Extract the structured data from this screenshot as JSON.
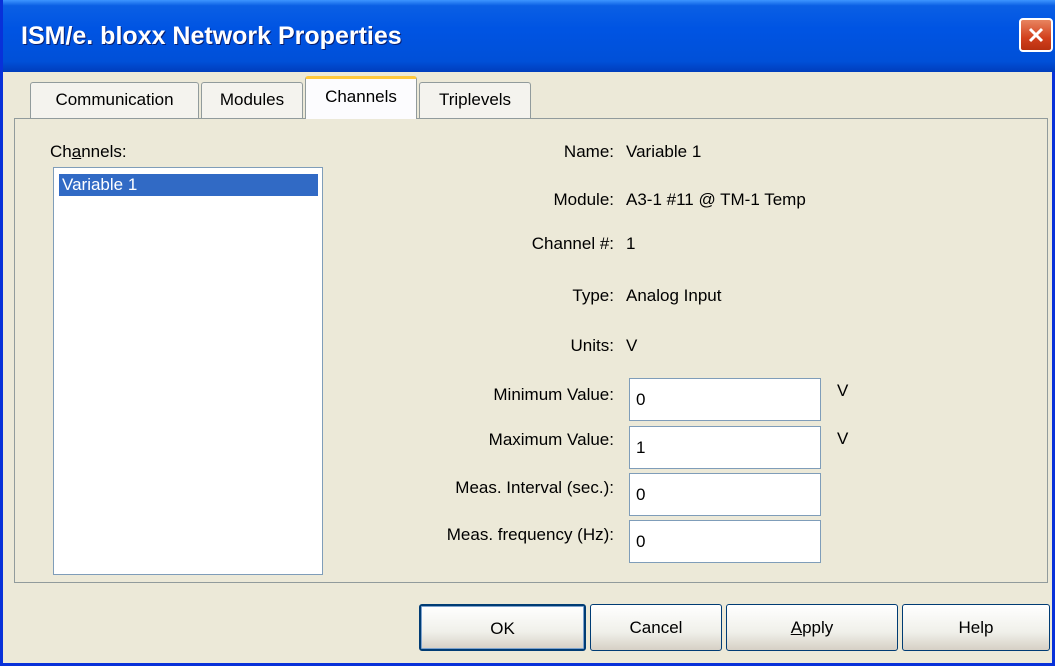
{
  "window": {
    "title": "ISM/e. bloxx Network Properties"
  },
  "tabs": [
    {
      "label": "Communication",
      "active": false
    },
    {
      "label": "Modules",
      "active": false
    },
    {
      "label": "Channels",
      "active": true
    },
    {
      "label": "Triplevels",
      "active": false
    }
  ],
  "channels": {
    "label_pre": "Ch",
    "label_mnemonic": "a",
    "label_post": "nnels:",
    "items": [
      {
        "label": "Variable 1",
        "selected": true
      }
    ]
  },
  "details": {
    "name_label": "Name:",
    "name_value": "Variable 1",
    "module_label": "Module:",
    "module_value": "A3-1 #11 @ TM-1 Temp",
    "channel_label": "Channel #:",
    "channel_value": "1",
    "type_label": "Type:",
    "type_value": "Analog Input",
    "units_label": "Units:",
    "units_value": "V"
  },
  "fields": {
    "min_label": "Minimum Value:",
    "min_value": "0",
    "min_unit": "V",
    "max_label": "Maximum Value:",
    "max_value": "1",
    "max_unit": "V",
    "interval_label": "Meas. Interval (sec.):",
    "interval_value": "0",
    "frequency_label": "Meas. frequency (Hz):",
    "frequency_value": "0"
  },
  "buttons": {
    "ok": "OK",
    "cancel": "Cancel",
    "apply_mnemonic": "A",
    "apply_rest": "pply",
    "help": "Help"
  },
  "colors": {
    "titlebar": "#0054e3",
    "selection": "#316ac5",
    "close_button": "#d2401d",
    "active_tab_accent": "#ffc83c"
  }
}
